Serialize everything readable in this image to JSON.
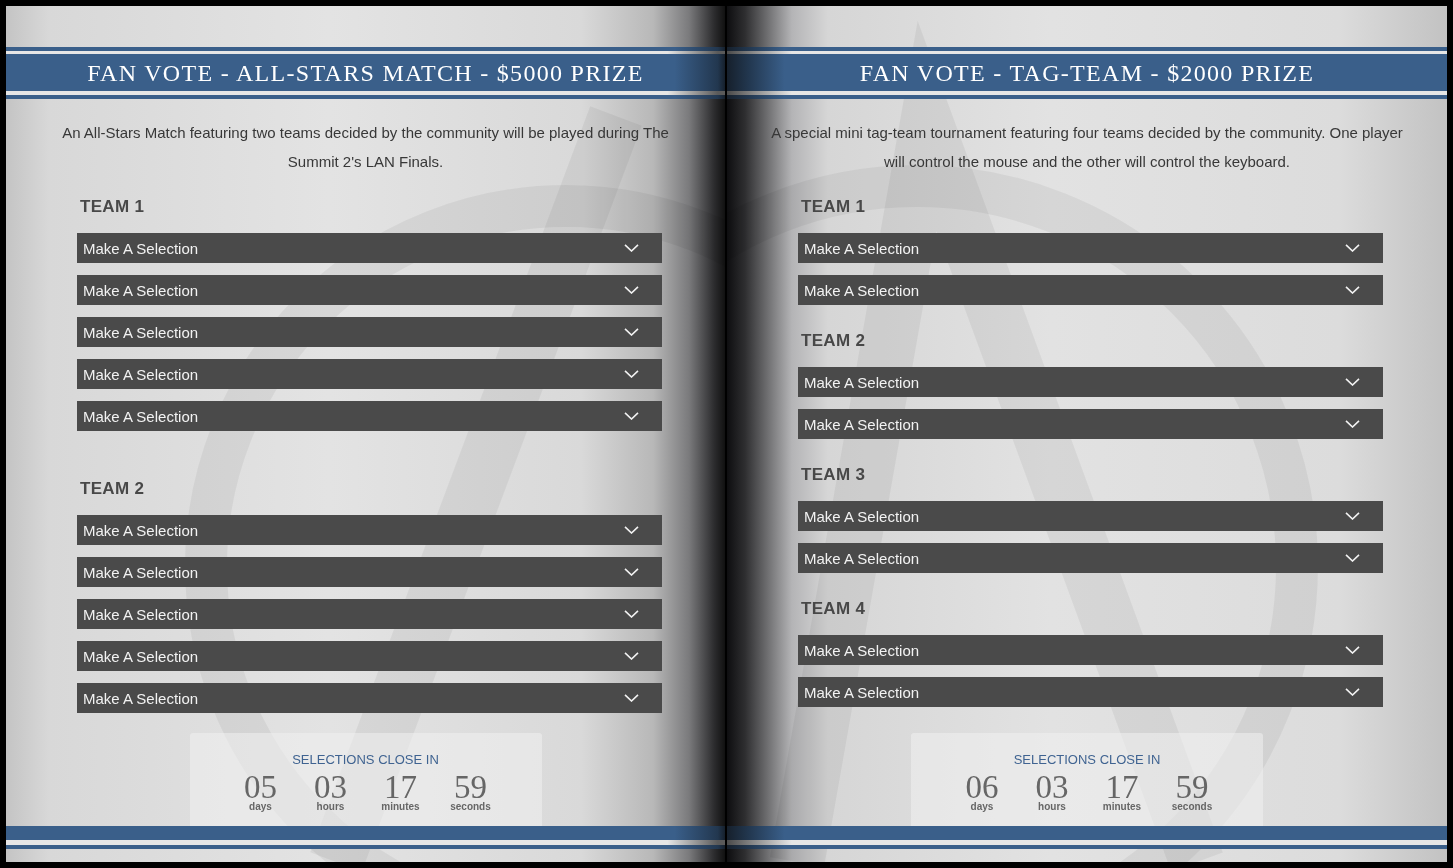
{
  "pages": [
    {
      "title": "FAN VOTE - ALL-STARS MATCH - $5000 PRIZE",
      "description": "An All-Stars Match featuring two teams decided by the community will be played during The Summit 2's LAN Finals.",
      "teams": [
        {
          "label": "TEAM 1",
          "dropdowns": [
            {
              "placeholder": "Make A Selection"
            },
            {
              "placeholder": "Make A Selection"
            },
            {
              "placeholder": "Make A Selection"
            },
            {
              "placeholder": "Make A Selection"
            },
            {
              "placeholder": "Make A Selection"
            }
          ]
        },
        {
          "label": "TEAM 2",
          "dropdowns": [
            {
              "placeholder": "Make A Selection"
            },
            {
              "placeholder": "Make A Selection"
            },
            {
              "placeholder": "Make A Selection"
            },
            {
              "placeholder": "Make A Selection"
            },
            {
              "placeholder": "Make A Selection"
            }
          ]
        }
      ],
      "countdown": {
        "heading": "SELECTIONS CLOSE IN",
        "units": [
          {
            "value": "05",
            "label": "days"
          },
          {
            "value": "03",
            "label": "hours"
          },
          {
            "value": "17",
            "label": "minutes"
          },
          {
            "value": "59",
            "label": "seconds"
          }
        ]
      }
    },
    {
      "title": "FAN VOTE - TAG-TEAM - $2000 PRIZE",
      "description": "A special mini tag-team tournament featuring four teams decided by the community. One player will control the mouse and the other will control the keyboard.",
      "teams": [
        {
          "label": "TEAM 1",
          "dropdowns": [
            {
              "placeholder": "Make A Selection"
            },
            {
              "placeholder": "Make A Selection"
            }
          ]
        },
        {
          "label": "TEAM 2",
          "dropdowns": [
            {
              "placeholder": "Make A Selection"
            },
            {
              "placeholder": "Make A Selection"
            }
          ]
        },
        {
          "label": "TEAM 3",
          "dropdowns": [
            {
              "placeholder": "Make A Selection"
            },
            {
              "placeholder": "Make A Selection"
            }
          ]
        },
        {
          "label": "TEAM 4",
          "dropdowns": [
            {
              "placeholder": "Make A Selection"
            },
            {
              "placeholder": "Make A Selection"
            }
          ]
        }
      ],
      "countdown": {
        "heading": "SELECTIONS CLOSE IN",
        "units": [
          {
            "value": "06",
            "label": "days"
          },
          {
            "value": "03",
            "label": "hours"
          },
          {
            "value": "17",
            "label": "minutes"
          },
          {
            "value": "59",
            "label": "seconds"
          }
        ]
      }
    }
  ]
}
